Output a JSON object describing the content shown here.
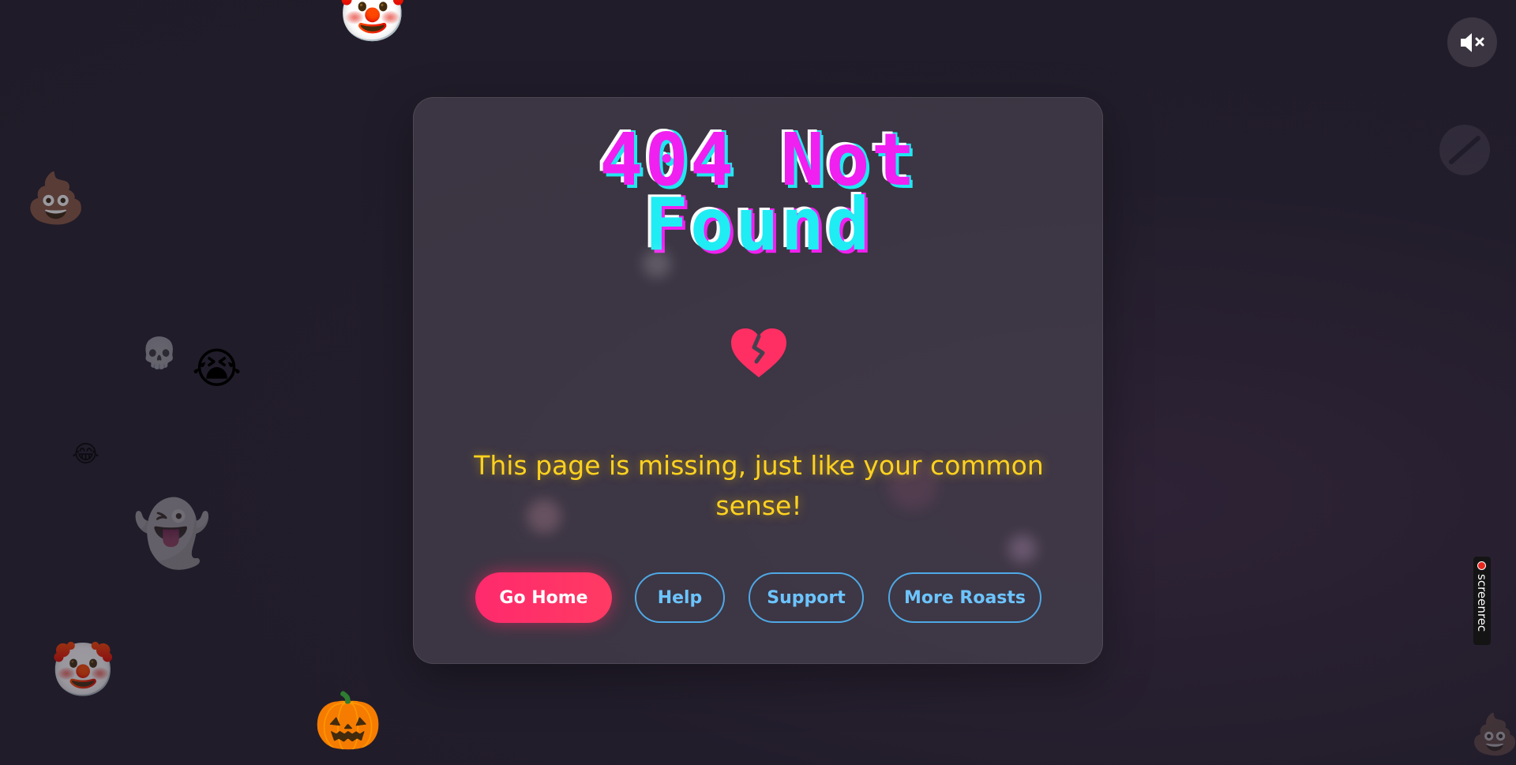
{
  "title": {
    "line1": "404 Not",
    "line2": "Found"
  },
  "message": "This page is missing, just like your common sense!",
  "buttons": {
    "home": "Go Home",
    "help": "Help",
    "support": "Support",
    "roasts": "More Roasts"
  },
  "recorder_badge": "screenrec",
  "icons": {
    "mute": "speaker-muted-icon",
    "heart": "broken-heart-icon"
  },
  "decor_emojis": {
    "clown": "🤡",
    "poop": "💩",
    "skull": "💀",
    "crying": "😭",
    "laughing": "😂",
    "ghost": "👻",
    "pumpkin": "🎃"
  },
  "colors": {
    "accent_pink": "#ff2a6d",
    "outline_blue": "#4fa9e6",
    "message_yellow": "#ffd21f",
    "title_magenta": "#f020f0",
    "title_cyan": "#20ecf4"
  }
}
